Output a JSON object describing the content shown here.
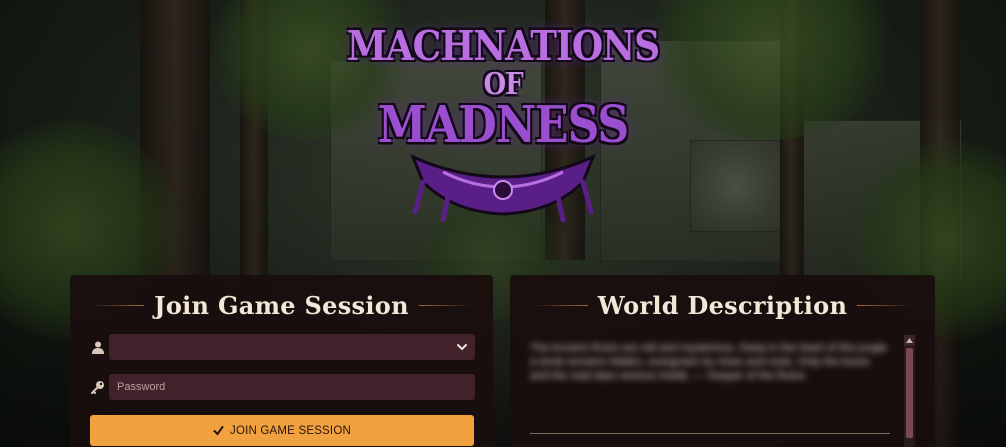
{
  "logo": {
    "line1": "MACHNATIONS",
    "line2": "OF",
    "line3": "MADNESS"
  },
  "join_panel": {
    "title": "Join Game Session",
    "user_select": {
      "value": "",
      "icon": "user-icon"
    },
    "password": {
      "placeholder": "Password",
      "value": "",
      "icon": "key-icon"
    },
    "join_button": {
      "label": "JOIN GAME SESSION",
      "icon": "check-icon"
    }
  },
  "world_panel": {
    "title": "World Description",
    "description": "The Ancient Ruins are old and mysterious. Deep in the heart of the jungle a tomb remains hidden, overgrown by vines and roots. Only the brave and the mad dare venture inside. — Keeper of the Ruins"
  },
  "colors": {
    "accent": "#f0a240",
    "panel_bg": "#180e0e",
    "field_bg": "#42222a",
    "logo_purple": "#b86ee0"
  }
}
